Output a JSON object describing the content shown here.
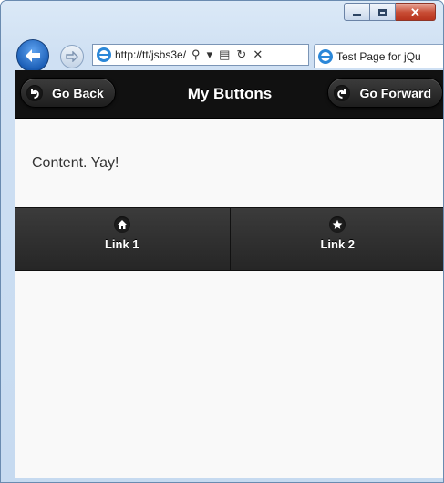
{
  "browser": {
    "address_url": "http://tt/jsbs3e/",
    "tab_title": "Test Page for jQu"
  },
  "header": {
    "back_label": "Go Back",
    "title": "My Buttons",
    "forward_label": "Go Forward"
  },
  "content": {
    "text": "Content. Yay!"
  },
  "navbar": {
    "links": [
      {
        "label": "Link 1",
        "icon": "home-icon"
      },
      {
        "label": "Link 2",
        "icon": "star-icon"
      }
    ]
  }
}
